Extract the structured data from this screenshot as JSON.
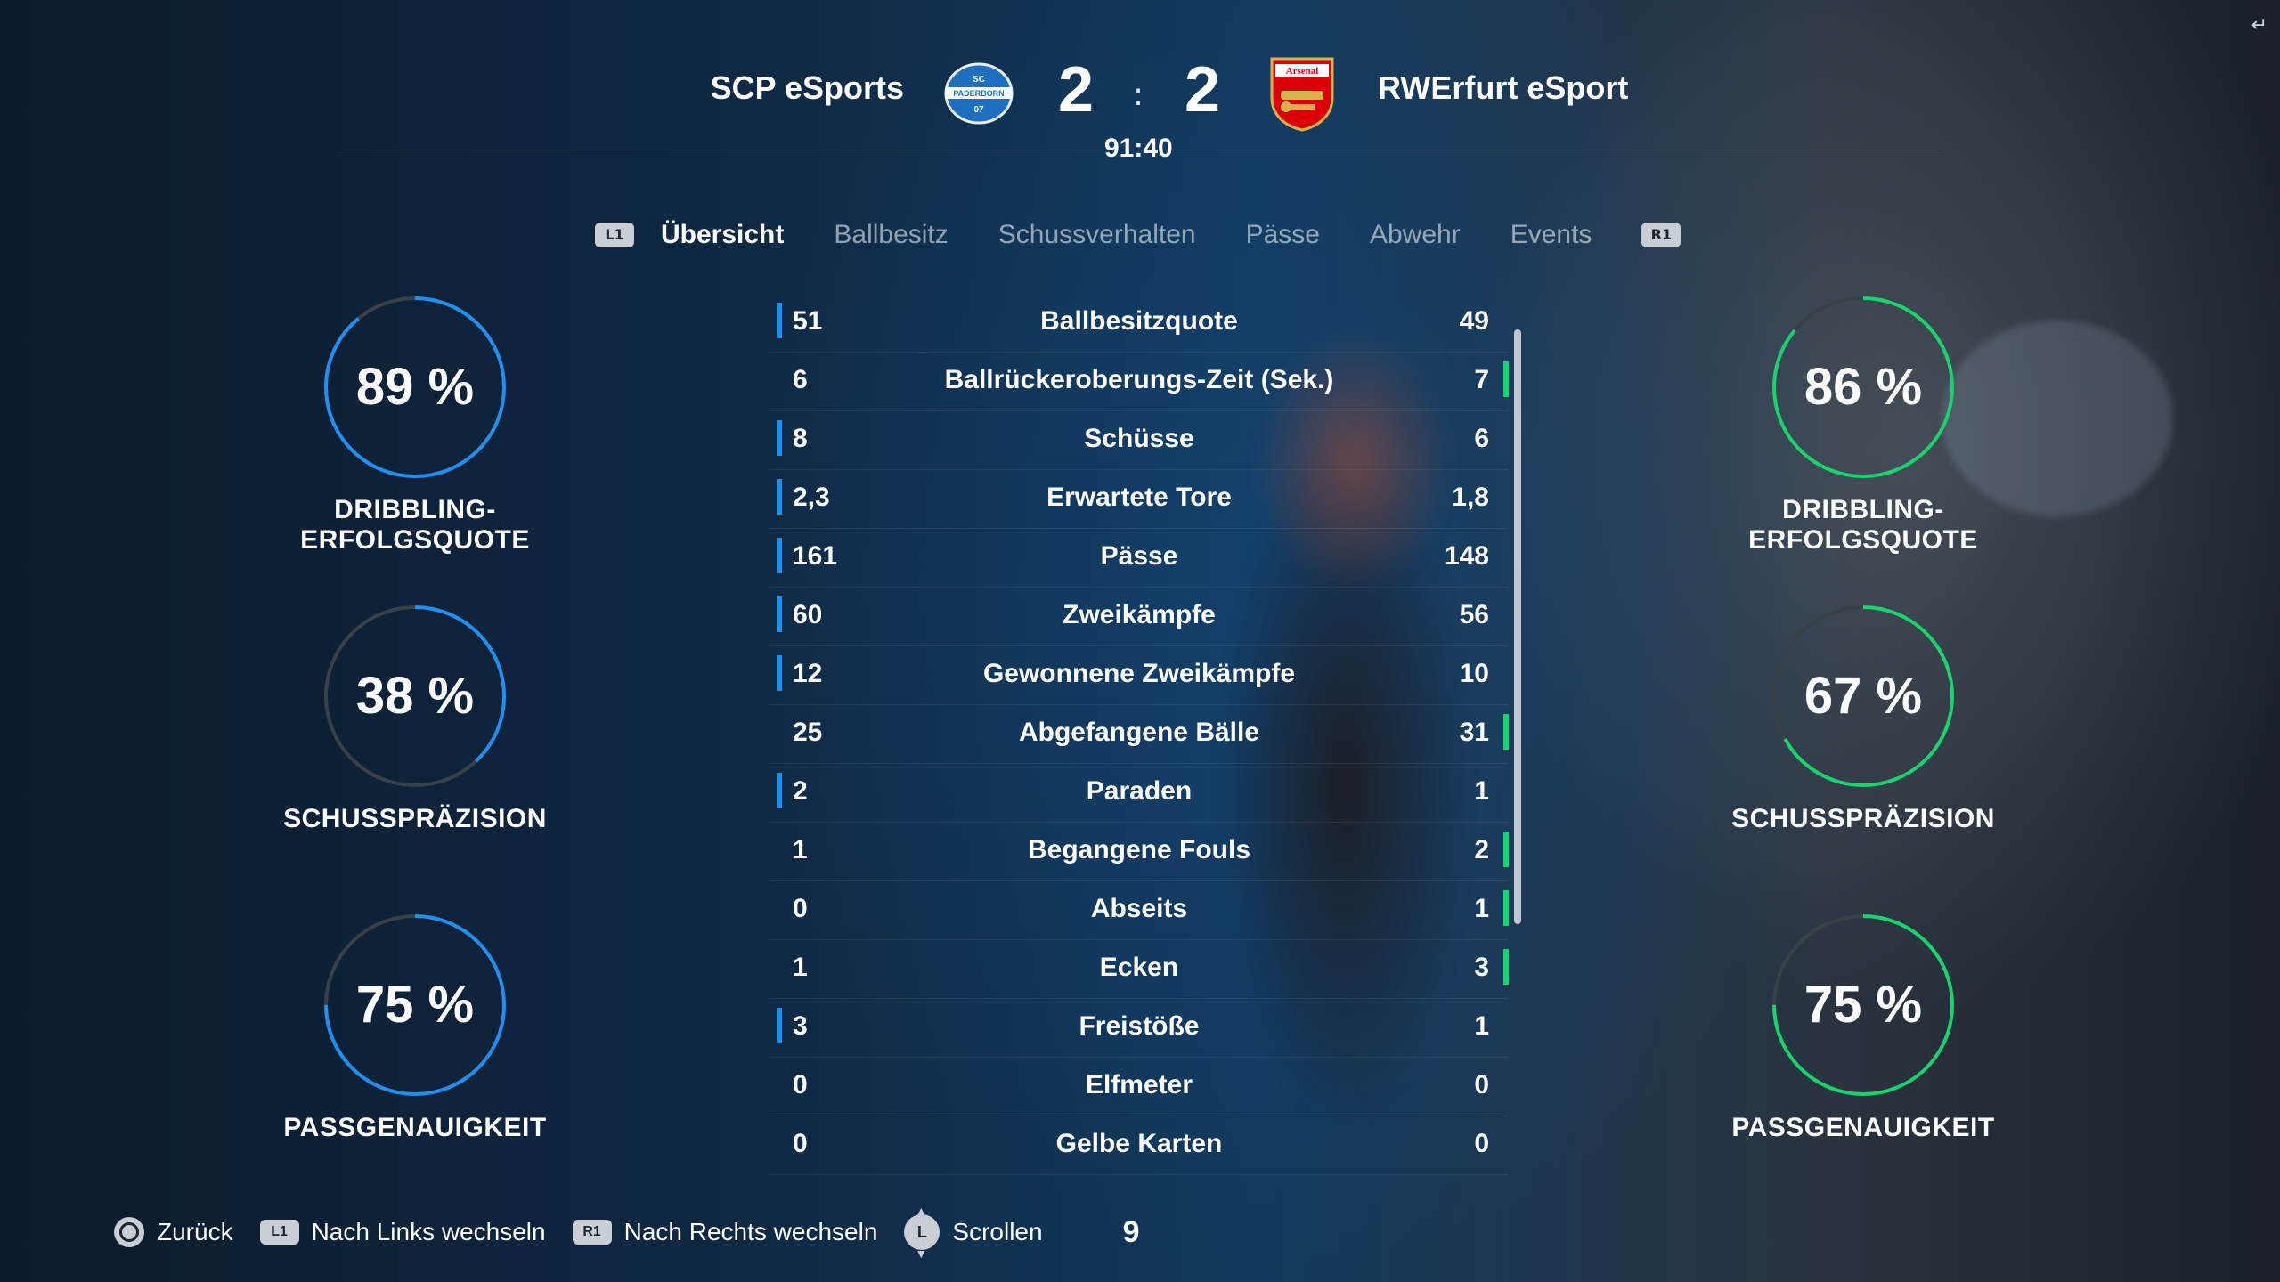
{
  "match": {
    "home_team": "SCP eSports",
    "away_team": "RWErfurt eSport",
    "home_score": "2",
    "away_score": "2",
    "score_separator": ":",
    "clock": "91:40",
    "home_crest_text": [
      "SC",
      "PADERBORN",
      "07"
    ],
    "away_crest_text": "Arsenal"
  },
  "tabs": {
    "left_button": "L1",
    "right_button": "R1",
    "items": [
      {
        "label": "Übersicht",
        "active": true
      },
      {
        "label": "Ballbesitz",
        "active": false
      },
      {
        "label": "Schussverhalten",
        "active": false
      },
      {
        "label": "Pässe",
        "active": false
      },
      {
        "label": "Abwehr",
        "active": false
      },
      {
        "label": "Events",
        "active": false
      }
    ]
  },
  "home_rings": [
    {
      "value": "89 %",
      "percent": 89,
      "label": "DRIBBLING-ERFOLGSQUOTE"
    },
    {
      "value": "38 %",
      "percent": 38,
      "label": "SCHUSSPRÄZISION"
    },
    {
      "value": "75 %",
      "percent": 75,
      "label": "PASSGENAUIGKEIT"
    }
  ],
  "away_rings": [
    {
      "value": "86 %",
      "percent": 86,
      "label": "DRIBBLING-ERFOLGSQUOTE"
    },
    {
      "value": "67 %",
      "percent": 67,
      "label": "SCHUSSPRÄZISION"
    },
    {
      "value": "75 %",
      "percent": 75,
      "label": "PASSGENAUIGKEIT"
    }
  ],
  "stats": [
    {
      "home": "51",
      "name": "Ballbesitzquote",
      "away": "49",
      "leader": "home"
    },
    {
      "home": "6",
      "name": "Ballrückeroberungs-Zeit (Sek.)",
      "away": "7",
      "leader": "away"
    },
    {
      "home": "8",
      "name": "Schüsse",
      "away": "6",
      "leader": "home"
    },
    {
      "home": "2,3",
      "name": "Erwartete Tore",
      "away": "1,8",
      "leader": "home"
    },
    {
      "home": "161",
      "name": "Pässe",
      "away": "148",
      "leader": "home"
    },
    {
      "home": "60",
      "name": "Zweikämpfe",
      "away": "56",
      "leader": "home"
    },
    {
      "home": "12",
      "name": "Gewonnene Zweikämpfe",
      "away": "10",
      "leader": "home"
    },
    {
      "home": "25",
      "name": "Abgefangene Bälle",
      "away": "31",
      "leader": "away"
    },
    {
      "home": "2",
      "name": "Paraden",
      "away": "1",
      "leader": "home"
    },
    {
      "home": "1",
      "name": "Begangene Fouls",
      "away": "2",
      "leader": "away"
    },
    {
      "home": "0",
      "name": "Abseits",
      "away": "1",
      "leader": "away"
    },
    {
      "home": "1",
      "name": "Ecken",
      "away": "3",
      "leader": "away"
    },
    {
      "home": "3",
      "name": "Freistöße",
      "away": "1",
      "leader": "home"
    },
    {
      "home": "0",
      "name": "Elfmeter",
      "away": "0",
      "leader": "none"
    },
    {
      "home": "0",
      "name": "Gelbe Karten",
      "away": "0",
      "leader": "none"
    }
  ],
  "footer": {
    "back_label": "Zurück",
    "l1_badge": "L1",
    "left_label": "Nach Links wechseln",
    "r1_badge": "R1",
    "right_label": "Nach Rechts wechseln",
    "stick_badge": "L",
    "scroll_label": "Scrollen",
    "page_number": "9"
  },
  "colors": {
    "home_accent": "#1f8ff0",
    "away_accent": "#19d46d",
    "ring_track": "#3a4048"
  },
  "icons": {
    "corner": "↵"
  }
}
